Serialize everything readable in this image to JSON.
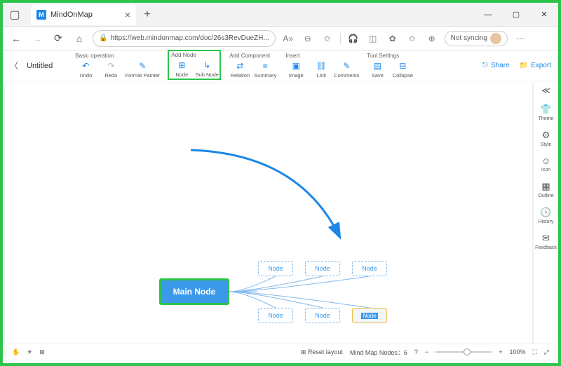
{
  "browser": {
    "tab_title": "MindOnMap",
    "url": "https://web.mindonmap.com/doc/26s3RevDueZH...",
    "sync_label": "Not syncing"
  },
  "toolbar": {
    "doc_title": "Untitled",
    "groups": {
      "basic": {
        "label": "Basic operation",
        "undo": "Undo",
        "redo": "Redo",
        "format": "Format Painter"
      },
      "addnode": {
        "label": "Add Node",
        "node": "Node",
        "subnode": "Sub Node"
      },
      "addcomp": {
        "label": "Add Component",
        "relation": "Relation",
        "summary": "Summary"
      },
      "insert": {
        "label": "Insert",
        "image": "Image",
        "link": "Link",
        "comments": "Comments"
      },
      "settings": {
        "label": "Tool Settings",
        "save": "Save",
        "collapse": "Collapse"
      }
    },
    "share": "Share",
    "export": "Export"
  },
  "sidepanel": {
    "theme": "Theme",
    "style": "Style",
    "icon": "Icon",
    "outline": "Outline",
    "history": "History",
    "feedback": "Feedback"
  },
  "mindmap": {
    "main": "Main Node",
    "children": [
      "Node",
      "Node",
      "Node",
      "Node",
      "Node",
      "Node"
    ]
  },
  "statusbar": {
    "reset": "Reset layout",
    "nodes_label": "Mind Map Nodes：6",
    "zoom": "100%"
  }
}
